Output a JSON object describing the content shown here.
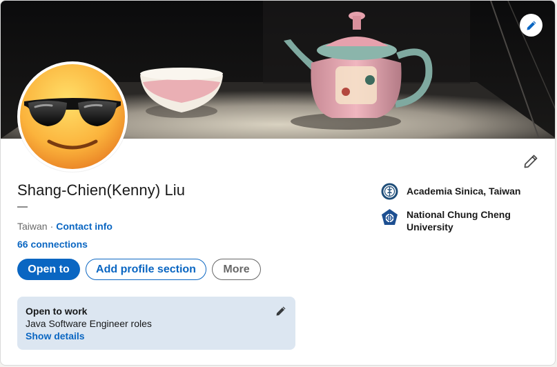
{
  "profile": {
    "name": "Shang-Chien(Kenny) Liu",
    "headline": "—",
    "location": "Taiwan",
    "separator": "·",
    "contact_info_label": "Contact info",
    "connections_label": "66 connections"
  },
  "actions": {
    "open_to_label": "Open to",
    "add_section_label": "Add profile section",
    "more_label": "More"
  },
  "open_to_work": {
    "title": "Open to work",
    "roles": "Java Software Engineer roles",
    "show_details_label": "Show details"
  },
  "education": [
    {
      "name": "Academia Sinica, Taiwan",
      "logo": "academia-sinica-logo"
    },
    {
      "name": "National Chung Cheng University",
      "logo": "ccu-logo"
    }
  ],
  "icons": {
    "cover_edit": "pencil-icon",
    "intro_edit": "pencil-icon",
    "avatar": "sunglasses-emoji"
  },
  "colors": {
    "brand_blue": "#0a66c2",
    "open_to_work_bg": "#dce6f1"
  }
}
